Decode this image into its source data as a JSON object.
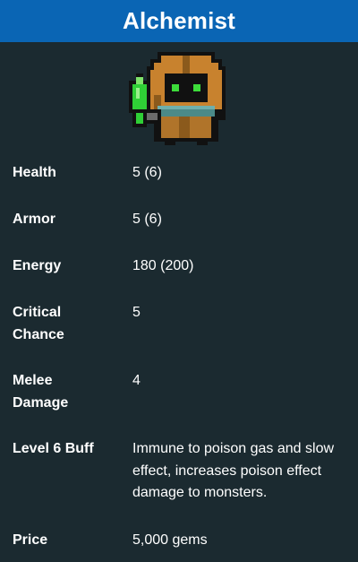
{
  "header": {
    "title": "Alchemist"
  },
  "character": {
    "icon": "alchemist-hooded-character-icon",
    "colors": {
      "hood": "#c8822e",
      "hood_trim": "#8b5a1c",
      "face": "#111111",
      "eyes": "#3ddc3a",
      "flask": "#2fcf36",
      "scarf": "#4b8a88",
      "robe": "#b0742a"
    }
  },
  "stats": [
    {
      "label": "Health",
      "value": "5 (6)"
    },
    {
      "label": "Armor",
      "value": "5 (6)"
    },
    {
      "label": "Energy",
      "value": "180 (200)"
    },
    {
      "label": "Critical Chance",
      "value": "5"
    },
    {
      "label": "Melee Damage",
      "value": "4"
    },
    {
      "label": "Level 6 Buff",
      "value": "Immune to poison gas and slow effect, increases poison effect damage to monsters."
    },
    {
      "label": "Price",
      "value": "5,000 gems"
    }
  ],
  "colors": {
    "header_bg": "#0a65b4",
    "page_bg": "#1b2a30",
    "text": "#ffffff"
  }
}
